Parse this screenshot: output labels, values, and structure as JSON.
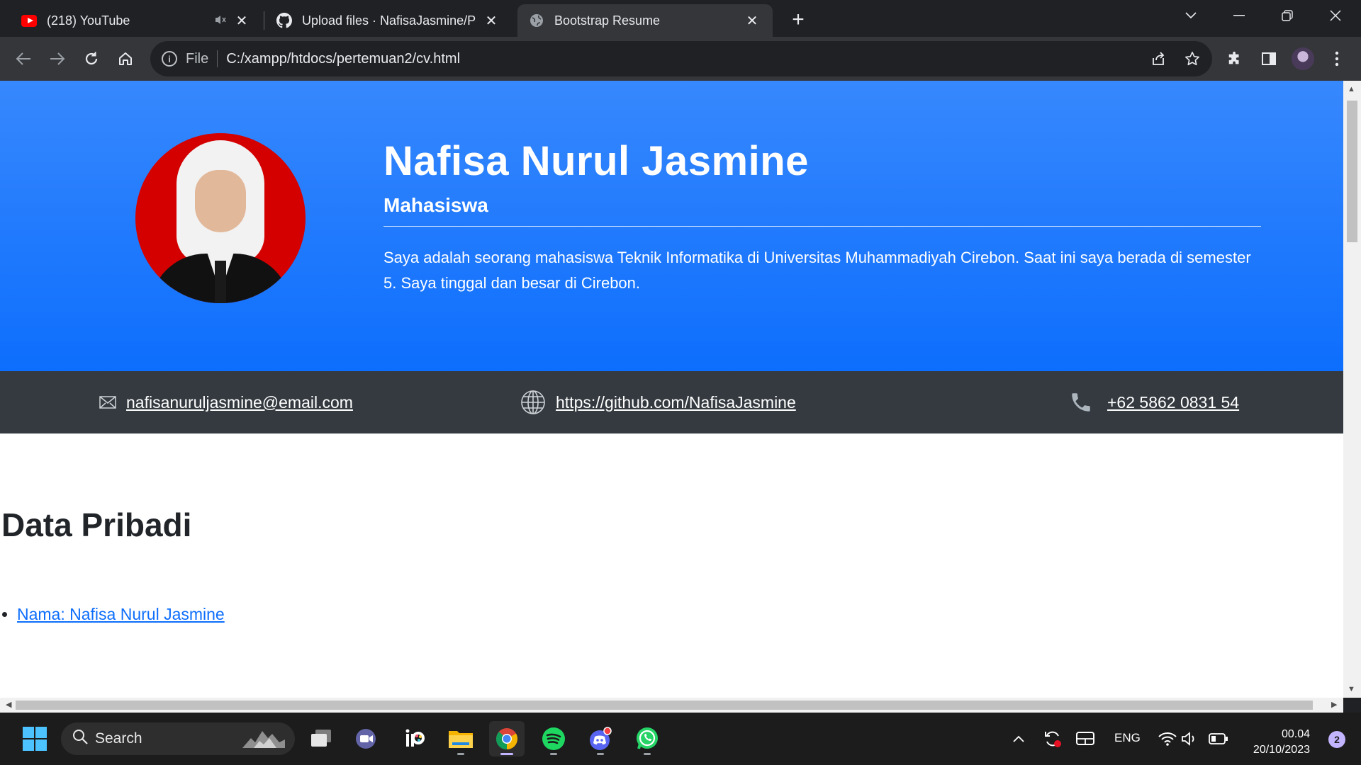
{
  "browser": {
    "tabs": [
      {
        "title": "(218) YouTube",
        "favicon": "youtube-icon"
      },
      {
        "title": "Upload files · NafisaJasmine/Pertemuan",
        "favicon": "github-icon"
      },
      {
        "title": "Bootstrap Resume",
        "favicon": "globe-icon",
        "active": true
      }
    ],
    "address": {
      "scheme": "File",
      "url": "C:/xampp/htdocs/pertemuan2/cv.html"
    }
  },
  "page": {
    "hero": {
      "name": "Nafisa Nurul Jasmine",
      "role": "Mahasiswa",
      "bio": "Saya adalah seorang mahasiswa Teknik Informatika di Universitas Muhammadiyah Cirebon. Saat ini saya berada di semester 5. Saya tinggal dan besar di Cirebon.",
      "bg_color": "#0d6efd"
    },
    "contact": {
      "email": "nafisanuruljasmine@email.com",
      "github": "https://github.com/NafisaJasmine",
      "phone": "+62 5862 0831 54",
      "bg_color": "#343a40"
    },
    "section": {
      "title": "Data Pribadi",
      "items": [
        "Nama: Nafisa Nurul Jasmine"
      ]
    }
  },
  "taskbar": {
    "search_label": "Search",
    "language": "ENG",
    "time": "00.04",
    "date": "20/10/2023",
    "notification_count": "2",
    "apps": [
      "task-view",
      "teams",
      "ibis-paint",
      "file-explorer",
      "chrome",
      "spotify",
      "discord",
      "whatsapp"
    ]
  }
}
